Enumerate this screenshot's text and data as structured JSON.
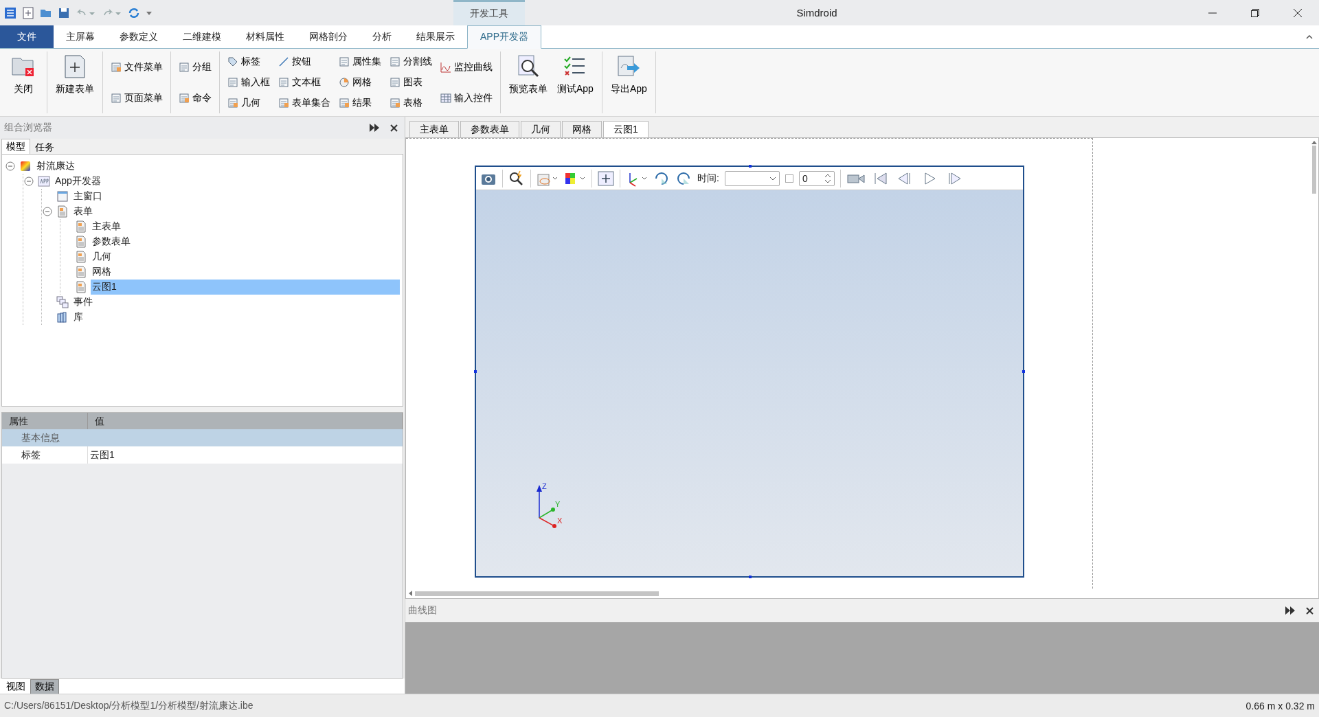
{
  "window": {
    "title": "Simdroid",
    "context_tab": "开发工具"
  },
  "menu": [
    {
      "label": "文件",
      "kind": "file",
      "selected": false
    },
    {
      "label": "主屏幕",
      "kind": "tab",
      "selected": false
    },
    {
      "label": "参数定义",
      "kind": "tab",
      "selected": false
    },
    {
      "label": "二维建模",
      "kind": "tab",
      "selected": false
    },
    {
      "label": "材料属性",
      "kind": "tab",
      "selected": false
    },
    {
      "label": "网格剖分",
      "kind": "tab",
      "selected": false
    },
    {
      "label": "分析",
      "kind": "tab",
      "selected": false
    },
    {
      "label": "结果展示",
      "kind": "tab",
      "selected": false
    },
    {
      "label": "APP开发器",
      "kind": "tab",
      "selected": true
    }
  ],
  "ribbon": [
    {
      "columns": [
        {
          "kind": "large",
          "items": [
            "关闭"
          ]
        }
      ]
    },
    {
      "columns": [
        {
          "kind": "large",
          "items": [
            "新建表单"
          ]
        }
      ]
    },
    {
      "columns": [
        {
          "kind": "small",
          "items": [
            "文件菜单",
            "页面菜单"
          ]
        }
      ]
    },
    {
      "columns": [
        {
          "kind": "small",
          "items": [
            "分组",
            "命令"
          ]
        }
      ]
    },
    {
      "columns": [
        {
          "kind": "small",
          "items": [
            "标签",
            "输入框",
            "几何"
          ]
        },
        {
          "kind": "small",
          "items": [
            "按钮",
            "文本框",
            "表单集合"
          ]
        },
        {
          "kind": "small",
          "items": [
            "属性集",
            "网格",
            "结果"
          ]
        },
        {
          "kind": "small",
          "items": [
            "分割线",
            "图表",
            "表格"
          ]
        },
        {
          "kind": "small",
          "items": [
            "监控曲线",
            "输入控件"
          ]
        }
      ]
    },
    {
      "columns": [
        {
          "kind": "large",
          "items": [
            "预览表单"
          ]
        },
        {
          "kind": "large",
          "items": [
            "测试App"
          ]
        }
      ]
    },
    {
      "columns": [
        {
          "kind": "large",
          "items": [
            "导出App"
          ]
        }
      ]
    }
  ],
  "browser": {
    "title": "组合浏览器",
    "tabs": [
      {
        "label": "模型",
        "selected": true
      },
      {
        "label": "任务",
        "selected": false
      }
    ],
    "tree": [
      {
        "label": "射流康达",
        "kind": "project",
        "expanded": true,
        "selected": false,
        "children": [
          {
            "label": "App开发器",
            "kind": "app",
            "expanded": true,
            "selected": false,
            "children": [
              {
                "label": "主窗口",
                "kind": "window",
                "selected": false
              },
              {
                "label": "表单",
                "kind": "form",
                "expanded": true,
                "selected": false,
                "children": [
                  {
                    "label": "主表单",
                    "kind": "form",
                    "selected": false
                  },
                  {
                    "label": "参数表单",
                    "kind": "form",
                    "selected": false
                  },
                  {
                    "label": "几何",
                    "kind": "form",
                    "selected": false
                  },
                  {
                    "label": "网格",
                    "kind": "form",
                    "selected": false
                  },
                  {
                    "label": "云图1",
                    "kind": "form",
                    "selected": true
                  }
                ]
              },
              {
                "label": "事件",
                "kind": "event",
                "selected": false
              },
              {
                "label": "库",
                "kind": "library",
                "selected": false
              }
            ]
          }
        ]
      }
    ],
    "properties": {
      "columns": [
        "属性",
        "值"
      ],
      "section": "基本信息",
      "rows": [
        {
          "name": "标签",
          "value": "云图1"
        }
      ]
    },
    "bottom_tabs": [
      {
        "label": "视图",
        "selected": true
      },
      {
        "label": "数据",
        "selected": false
      }
    ]
  },
  "doc_tabs": [
    {
      "label": "主表单",
      "selected": false
    },
    {
      "label": "参数表单",
      "selected": false
    },
    {
      "label": "几何",
      "selected": false
    },
    {
      "label": "网格",
      "selected": false
    },
    {
      "label": "云图1",
      "selected": true
    }
  ],
  "viewer": {
    "time_label": "时间:",
    "frame_checked": false,
    "frame_value": "0",
    "axes": [
      "Z",
      "Y",
      "X"
    ]
  },
  "curve_panel": {
    "title": "曲线图"
  },
  "status_bar": {
    "path": "C:/Users/86151/Desktop/分析模型1/分析模型/射流康达.ibe",
    "size": "0.66 m x 0.32 m"
  }
}
